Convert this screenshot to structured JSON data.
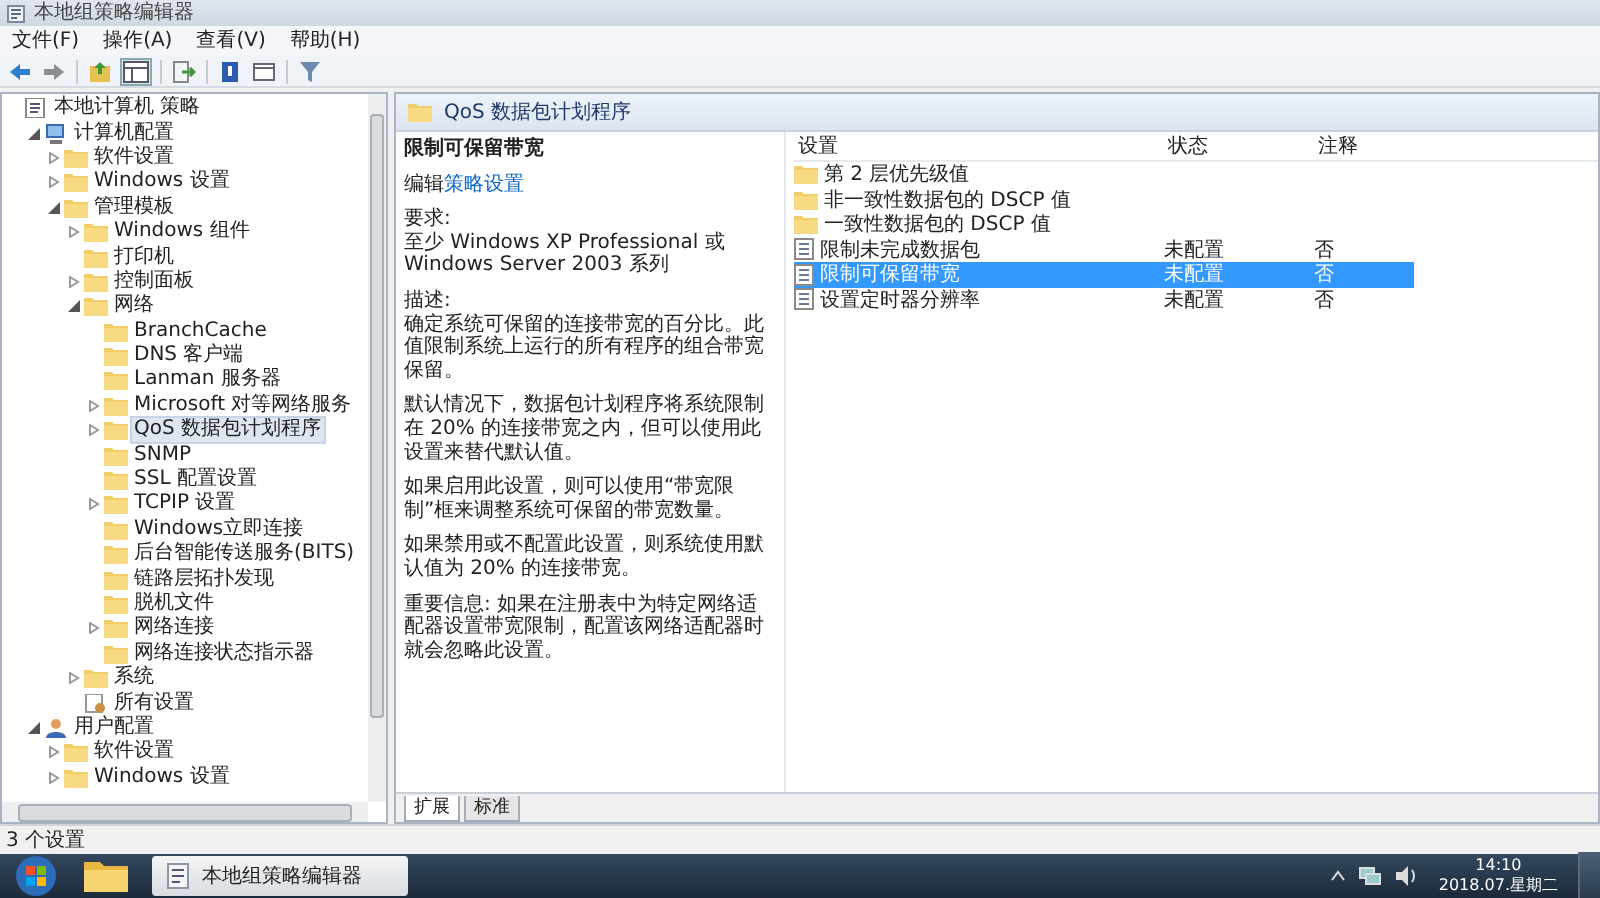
{
  "window": {
    "title": "本地组策略编辑器"
  },
  "menu": [
    "文件(F)",
    "操作(A)",
    "查看(V)",
    "帮助(H)"
  ],
  "tree": [
    {
      "label": "本地计算机 策略",
      "kind": "policy",
      "selected": false,
      "children": [
        {
          "label": "计算机配置",
          "kind": "computer",
          "expanded": true,
          "selected": false,
          "children": [
            {
              "label": "软件设置",
              "kind": "folder",
              "expanded": false,
              "selected": false
            },
            {
              "label": "Windows 设置",
              "kind": "folder",
              "expanded": false,
              "selected": false
            },
            {
              "label": "管理模板",
              "kind": "folder",
              "expanded": true,
              "selected": false,
              "children": [
                {
                  "label": "Windows 组件",
                  "kind": "folder",
                  "expanded": false,
                  "selected": false
                },
                {
                  "label": "打印机",
                  "kind": "folder",
                  "selected": false
                },
                {
                  "label": "控制面板",
                  "kind": "folder",
                  "expanded": false,
                  "selected": false
                },
                {
                  "label": "网络",
                  "kind": "folder",
                  "expanded": true,
                  "selected": false,
                  "children": [
                    {
                      "label": "BranchCache",
                      "kind": "folder",
                      "selected": false
                    },
                    {
                      "label": "DNS 客户端",
                      "kind": "folder",
                      "selected": false
                    },
                    {
                      "label": "Lanman 服务器",
                      "kind": "folder",
                      "selected": false
                    },
                    {
                      "label": "Microsoft 对等网络服务",
                      "kind": "folder",
                      "expanded": false,
                      "selected": false
                    },
                    {
                      "label": "QoS 数据包计划程序",
                      "kind": "folder",
                      "expanded": false,
                      "selected": true
                    },
                    {
                      "label": "SNMP",
                      "kind": "folder",
                      "selected": false
                    },
                    {
                      "label": "SSL 配置设置",
                      "kind": "folder",
                      "selected": false
                    },
                    {
                      "label": "TCPIP 设置",
                      "kind": "folder",
                      "expanded": false,
                      "selected": false
                    },
                    {
                      "label": "Windows立即连接",
                      "kind": "folder",
                      "selected": false
                    },
                    {
                      "label": "后台智能传送服务(BITS)",
                      "kind": "folder",
                      "selected": false
                    },
                    {
                      "label": "链路层拓扑发现",
                      "kind": "folder",
                      "selected": false
                    },
                    {
                      "label": "脱机文件",
                      "kind": "folder",
                      "selected": false
                    },
                    {
                      "label": "网络连接",
                      "kind": "folder",
                      "expanded": false,
                      "selected": false
                    },
                    {
                      "label": "网络连接状态指示器",
                      "kind": "folder",
                      "selected": false
                    }
                  ]
                },
                {
                  "label": "系统",
                  "kind": "folder",
                  "expanded": false,
                  "selected": false
                },
                {
                  "label": "所有设置",
                  "kind": "settings",
                  "selected": false
                }
              ]
            }
          ]
        },
        {
          "label": "用户配置",
          "kind": "user",
          "expanded": true,
          "selected": false,
          "children": [
            {
              "label": "软件设置",
              "kind": "folder",
              "expanded": false,
              "selected": false
            },
            {
              "label": "Windows 设置",
              "kind": "folder",
              "expanded": false,
              "selected": false
            }
          ]
        }
      ]
    }
  ],
  "header": {
    "title": "QoS 数据包计划程序"
  },
  "description": {
    "title": "限制可保留带宽",
    "edit_prefix": "编辑",
    "edit_link": "策略设置",
    "paragraphs": [
      "要求:\n至少 Windows XP Professional 或 Windows Server 2003 系列",
      "描述:\n确定系统可保留的连接带宽的百分比。此值限制系统上运行的所有程序的组合带宽保留。",
      "默认情况下，数据包计划程序将系统限制在 20% 的连接带宽之内，但可以使用此设置来替代默认值。",
      "如果启用此设置，则可以使用“带宽限制”框来调整系统可保留的带宽数量。",
      "如果禁用或不配置此设置，则系统使用默认值为 20% 的连接带宽。",
      "重要信息: 如果在注册表中为特定网络适配器设置带宽限制，配置该网络适配器时就会忽略此设置。"
    ]
  },
  "columns": [
    "设置",
    "状态",
    "注释"
  ],
  "rows": [
    {
      "kind": "folder",
      "name": "第 2 层优先级值",
      "selected": false
    },
    {
      "kind": "folder",
      "name": "非一致性数据包的 DSCP 值",
      "selected": false
    },
    {
      "kind": "folder",
      "name": "一致性数据包的 DSCP 值",
      "selected": false
    },
    {
      "kind": "setting",
      "name": "限制未完成数据包",
      "state": "未配置",
      "note": "否",
      "selected": false
    },
    {
      "kind": "setting",
      "name": "限制可保留带宽",
      "state": "未配置",
      "note": "否",
      "selected": true
    },
    {
      "kind": "setting",
      "name": "设置定时器分辨率",
      "state": "未配置",
      "note": "否",
      "selected": false
    }
  ],
  "tabs": [
    {
      "label": "扩展",
      "selected": true
    },
    {
      "label": "标准",
      "selected": false
    }
  ],
  "status_bar": "3 个设置",
  "taskbar": {
    "window_button": "本地组策略编辑器",
    "time": "14:10",
    "date": "2018.07.星期二"
  }
}
